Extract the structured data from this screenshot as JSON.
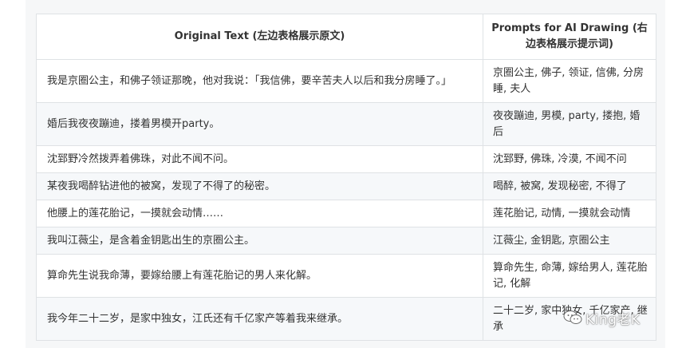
{
  "table": {
    "headers": [
      "Original Text (左边表格展示原文)",
      "Prompts for AI Drawing (右边表格展示提示词)"
    ],
    "rows": [
      {
        "original": "我是京圈公主，和佛子领证那晚，他对我说：「我信佛，要辛苦夫人以后和我分房睡了。」",
        "prompt": "京圈公主, 佛子, 领证, 信佛, 分房睡, 夫人"
      },
      {
        "original": "婚后我夜夜蹦迪，搂着男模开party。",
        "prompt": "夜夜蹦迪, 男模, party, 搂抱, 婚后"
      },
      {
        "original": "沈郅野冷然拨弄着佛珠，对此不闻不问。",
        "prompt": "沈郅野, 佛珠, 冷漠, 不闻不问"
      },
      {
        "original": "某夜我喝醉钻进他的被窝，发现了不得了的秘密。",
        "prompt": "喝醉, 被窝, 发现秘密, 不得了"
      },
      {
        "original": "他腰上的莲花胎记，一摸就会动情……",
        "prompt": "莲花胎记, 动情, 一摸就会动情"
      },
      {
        "original": "我叫江薇尘，是含着金钥匙出生的京圈公主。",
        "prompt": "江薇尘, 金钥匙, 京圈公主"
      },
      {
        "original": "算命先生说我命薄，要嫁给腰上有莲花胎记的男人来化解。",
        "prompt": "算命先生, 命薄, 嫁给男人, 莲花胎记, 化解"
      },
      {
        "original": "我今年二十二岁，是家中独女，江氏还有千亿家产等着我来继承。",
        "prompt": "二十二岁, 家中独女, 千亿家产, 继承"
      }
    ]
  },
  "watermark": {
    "text": "King老K",
    "icon": "wechat-icon"
  }
}
